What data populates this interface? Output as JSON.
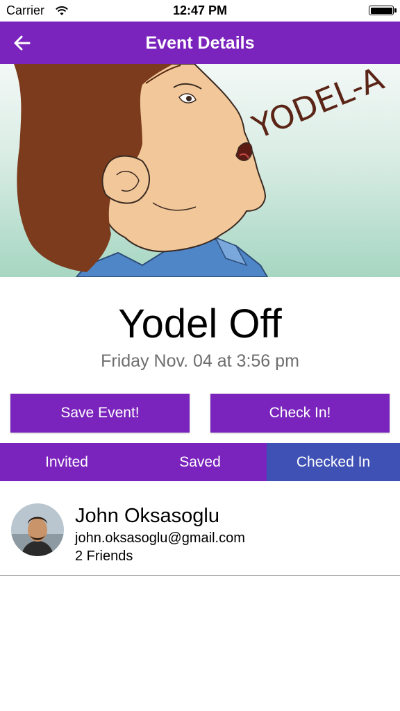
{
  "status_bar": {
    "carrier": "Carrier",
    "time": "12:47 PM"
  },
  "nav": {
    "title": "Event Details",
    "back_icon": "arrow-left-icon"
  },
  "hero": {
    "speech_text": "YODEL-A"
  },
  "event": {
    "title": "Yodel Off",
    "date": "Friday Nov. 04 at 3:56 pm"
  },
  "buttons": {
    "save_label": "Save Event!",
    "checkin_label": "Check In!"
  },
  "tabs": [
    {
      "label": "Invited",
      "active": false
    },
    {
      "label": "Saved",
      "active": false
    },
    {
      "label": "Checked In",
      "active": true
    }
  ],
  "attendees": [
    {
      "name": "John Oksasoglu",
      "email": "john.oksasoglu@gmail.com",
      "friends": "2 Friends"
    }
  ],
  "colors": {
    "primary": "#7b24bd",
    "active_tab": "#3f51b5"
  }
}
